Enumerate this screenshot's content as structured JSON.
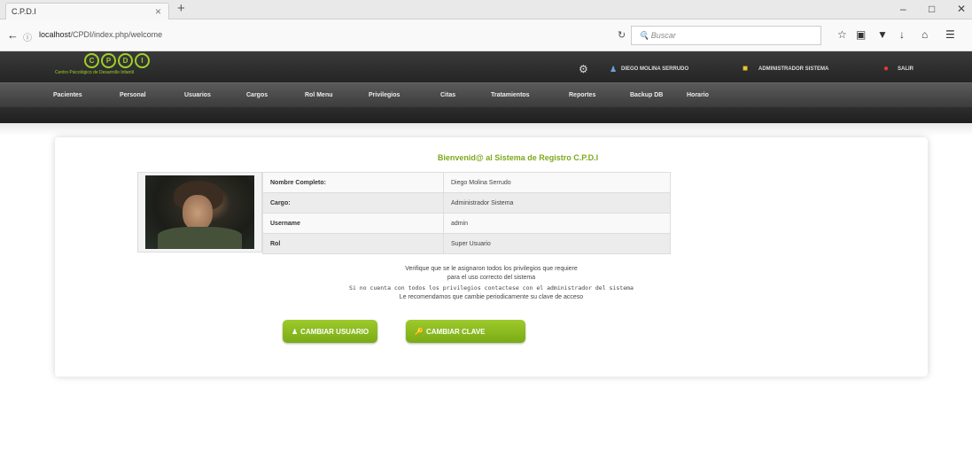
{
  "browser": {
    "tab_title": "C.P.D.I",
    "tab_close": "×",
    "new_tab": "+",
    "url_host": "localhost",
    "url_path": "/CPDI/index.php/welcome",
    "search_placeholder": "Buscar"
  },
  "header": {
    "logo_letters": [
      "C",
      "P",
      "D",
      "I"
    ],
    "logo_subtitle": "Centro Psicológico de Desarrollo Infantil",
    "user_name": "DIEGO MOLINA SERRUDO",
    "user_role": "ADMINISTRADOR SISTEMA",
    "logout": "SALIR"
  },
  "menu": [
    "Pacientes",
    "Personal",
    "Usuarios",
    "Cargos",
    "Rol Menu",
    "Privilegios",
    "Citas",
    "Tratamientos",
    "Reportes",
    "Backup DB",
    "Horario"
  ],
  "main": {
    "welcome": "Bienvenid@ al Sistema de Registro C.P.D.I",
    "rows": [
      {
        "label": "Nombre Completo:",
        "value": "Diego  Molina  Serrudo"
      },
      {
        "label": "Cargo:",
        "value": "Administrador Sistema"
      },
      {
        "label": "Username",
        "value": "admin"
      },
      {
        "label": "Rol",
        "value": "Super Usuario"
      }
    ],
    "msg1": "Verifique que se le asignaron todos los privilegios que requiere",
    "msg2": "para el uso correcto del sistema",
    "msg3": "Si no cuenta con todos los privilegios contactese con el administrador del sistema",
    "msg4": "Le recomendamos que cambie periodicamente su clave de acceso",
    "btn_user": "CAMBIAR USUARIO",
    "btn_pass": "CAMBIAR CLAVE"
  },
  "colors": {
    "accent": "#8dbd22",
    "header": "#2e2e2e"
  }
}
